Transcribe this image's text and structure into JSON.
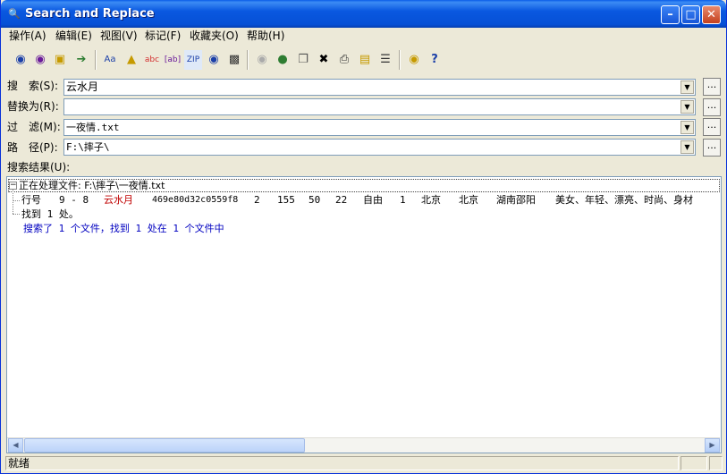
{
  "window": {
    "title": "Search and Replace"
  },
  "menu": [
    "操作(A)",
    "编辑(E)",
    "视图(V)",
    "标记(F)",
    "收藏夹(O)",
    "帮助(H)"
  ],
  "toolbar_icons": [
    "find-icon",
    "find-next-icon",
    "open-folder-icon",
    "move-icon",
    "replace-case-icon",
    "replace-icon",
    "replace-abc-icon",
    "replace-ab-icon",
    "search-zip-icon",
    "binoculars-icon",
    "find-in-files-icon",
    "disabled-tool-icon",
    "internet-icon",
    "copy-icon",
    "delete-icon",
    "print-icon",
    "notepad-icon",
    "options-icon",
    "tip-icon",
    "help-icon"
  ],
  "fields": {
    "search": {
      "label": "搜　索(S):",
      "value": "云水月"
    },
    "replace": {
      "label": "替换为(R):",
      "value": ""
    },
    "filter": {
      "label": "过　滤(M):",
      "value": "一夜情.txt"
    },
    "path": {
      "label": "路　径(P):",
      "value": "F:\\摔子\\"
    }
  },
  "browse_button_label": "...",
  "results": {
    "label": "搜索结果(U):",
    "processing": "正在处理文件: F:\\摔子\\一夜情.txt",
    "row": {
      "prefix": "行号",
      "line_numbers": "9 - 8",
      "match": "云水月",
      "hash": "469e80d32c0559f8",
      "cols": [
        "2",
        "155",
        "50",
        "22",
        "自由",
        "1",
        "北京",
        "北京",
        "湖南邵阳",
        "美女、年轻、漂亮、时尚、身材"
      ]
    },
    "found_line": "找到 1 处。",
    "summary": "搜索了 1 个文件，找到 1 处在 1 个文件中"
  },
  "status": {
    "text": "就绪"
  },
  "colors": {
    "match": "#c00000",
    "processing": "#00008b",
    "summary": "#0000c0"
  }
}
